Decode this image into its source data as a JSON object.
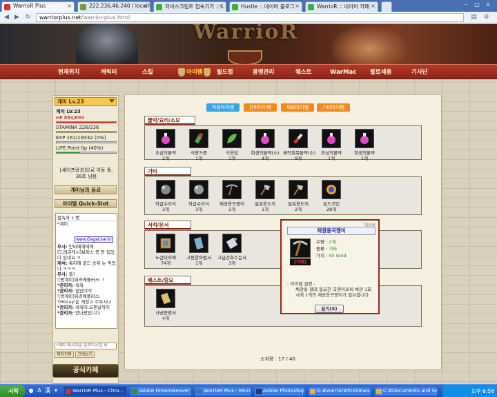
{
  "browser": {
    "tabs": [
      {
        "label": "WarrioR Plus",
        "fav": "#c33"
      },
      {
        "label": "222.236.46.240 / localhost / l",
        "fav": "#7a9c3c"
      },
      {
        "label": "자바스크립트 접속기가 :: L",
        "fav": "#3fae3f"
      },
      {
        "label": "Hustle :: 네이버 블로그",
        "fav": "#3fae3f"
      },
      {
        "label": "WarrioR :: 네이버 카페",
        "fav": "#3fae3f"
      }
    ],
    "url_host": "warriorplus.net",
    "url_path": "/warrior-plus.html"
  },
  "site": {
    "logo": "WarrioR",
    "menu": [
      "현재위치",
      "캐릭터",
      "스킬",
      "아이템",
      "월드맵",
      "용병관리",
      "퀘스트",
      "WarMac",
      "팔로세움",
      "기사단"
    ],
    "active_menu": "아이템"
  },
  "character": {
    "dropdown": "계미 Lv.23",
    "name_level": "계미 LV.23",
    "hp": "HP 893/893",
    "hp_frac": 1.0,
    "stamina": "STAMINA 226/236",
    "stamina_frac": 0.96,
    "exp": "EXP 161/19332 (0%)",
    "exp_frac": 0.01,
    "life_point": "LIFE Point 0p (40%)",
    "life_frac": 0.4,
    "status_note_1": "[세이프랑성]으로 이동 중,",
    "status_note_2": "38초 남음",
    "friends_btn": "계미님의 동료",
    "quickslot_btn": "아이템 Quick-Slot",
    "chat_list": [
      "접속자 1 명",
      "*계미"
    ],
    "gaga_badge": "www.GagaLive.kr",
    "chat_log": [
      {
        "n": "무사:",
        "t": " 안되에에에에"
      },
      {
        "n": "",
        "t": "[드래곤게시]보퍼스 증 등 입었다 있네요 ㅋ"
      },
      {
        "n": "재석:",
        "t": " 축하해 골드 승위 는 먹었다 ㅋㅋㅋ"
      },
      {
        "n": "무사:",
        "t": " 들?"
      },
      {
        "n": "",
        "t": "'[방계미]워라에플러스: ?"
      },
      {
        "n": "*관리자:",
        "t": " 워워"
      },
      {
        "n": "*관리자:",
        "t": " 집인이어"
      },
      {
        "n": "",
        "t": "'[방계미]워라에플러스: "
      },
      {
        "n": "",
        "t": "THGray'은 계정고 주무시나"
      },
      {
        "n": "*관리자:",
        "t": " 워워어 오픈날까지"
      },
      {
        "n": "*관리자:",
        "t": " 안나왔었니다"
      }
    ],
    "chat_input_placeholder": "*계미 메시지를 입력하시길 바",
    "btn_clear": "채팅전환",
    "btn_enlarge": "크게보기",
    "cafe_btn": "공식카페"
  },
  "inventory": {
    "tabs": [
      {
        "label": "착용아이템",
        "color": "#33a7e6"
      },
      {
        "label": "장비아이템",
        "color": "#f08a1a"
      },
      {
        "label": "재료아이템",
        "color": "#f08a1a"
      },
      {
        "label": "기타아이템",
        "color": "#f08a1a"
      }
    ],
    "categories": [
      {
        "title": "물약/요리/소모",
        "items": [
          {
            "name": "초심의물약",
            "qty": "2개",
            "icon": "potion-pink-icon",
            "color": "#e04ac8"
          },
          {
            "name": "식량가중",
            "qty": "1개",
            "icon": "herb-bottle-icon",
            "color": "#4aa840"
          },
          {
            "name": "식용임",
            "qty": "1개",
            "icon": "leaf-food-icon",
            "color": "#5ac040"
          },
          {
            "name": "회생의물약(소)",
            "qty": "4개",
            "icon": "potion-pink-icon",
            "color": "#e04ac8"
          },
          {
            "name": "체력회복물약(소)",
            "qty": "8개",
            "icon": "vial-red-icon",
            "color": "#d33"
          },
          {
            "name": "초심의물약",
            "qty": "1개",
            "icon": "potion-pink-icon",
            "color": "#e04ac8"
          },
          {
            "name": "회생의물약",
            "qty": "1개",
            "icon": "potion-pink-icon",
            "color": "#e04ac8"
          }
        ]
      },
      {
        "title": "기타",
        "items": [
          {
            "name": "하급수리석",
            "qty": "3개",
            "icon": "repair-stone-icon",
            "color": "#888"
          },
          {
            "name": "하급수리석",
            "qty": "3개",
            "icon": "repair-stone-icon",
            "color": "#999"
          },
          {
            "name": "채광용곡괭이",
            "qty": "2개",
            "icon": "pickaxe-icon",
            "color": "#bbb"
          },
          {
            "name": "벌목용도끼",
            "qty": "1개",
            "icon": "axe-icon",
            "color": "#ccc"
          },
          {
            "name": "벌목용도끼",
            "qty": "2개",
            "icon": "axe-icon",
            "color": "#ccc"
          },
          {
            "name": "골드코인",
            "qty": "28개",
            "icon": "gold-coin-icon",
            "color": "#f0a030"
          }
        ]
      },
      {
        "title": "서적/문서",
        "items": [
          {
            "name": "노련미의책",
            "qty": "74개",
            "icon": "book-icon",
            "color": "#c9a060"
          },
          {
            "name": "고봉한마법서",
            "qty": "1개",
            "icon": "spellbook-icon",
            "color": "#7ab0d0"
          },
          {
            "name": "고급강화주문서",
            "qty": "3개",
            "icon": "scroll-icon",
            "color": "#d8d8e8"
          }
        ]
      },
      {
        "title": "퀘스트/중요",
        "items": [
          {
            "name": "사냥증명서",
            "qty": "4개",
            "icon": "certificate-icon",
            "color": "#e0c070"
          }
        ]
      }
    ],
    "page_count": "소지량 : 17 / 40"
  },
  "popup": {
    "tag": "채광용",
    "title": "채광용곡괭이",
    "rank": "[거래]",
    "qty_label": "수량",
    "qty_value": "2개",
    "kind_label": "종류",
    "kind_value": "기타",
    "price_label": "가치",
    "price_value": "50 Gold",
    "desc_title": "- 아이템 설명 -",
    "desc": "채광을 할때 필요한 곡괭이로써 채광 1회 시에 1개의 채광용곡괭이가 필요합니다.",
    "close_label": "닫기(X)"
  },
  "taskbar": {
    "start": "시작",
    "tasks": [
      {
        "label": "WarrioR Plus - Chro...",
        "color": "#c33"
      },
      {
        "label": "Adobe Dreamweaver C...",
        "color": "#3a8a3a"
      },
      {
        "label": "WarrioR Plus - Microsoft...",
        "color": "#3d6fb8"
      },
      {
        "label": "Adobe Photoshop CS3 ...",
        "color": "#1d3b7a"
      },
      {
        "label": "D:#warrior#html#wa...",
        "color": "#e0b040"
      },
      {
        "label": "C:#Documents and Set...",
        "color": "#e0b040"
      }
    ],
    "clock": "오후 6:58"
  }
}
